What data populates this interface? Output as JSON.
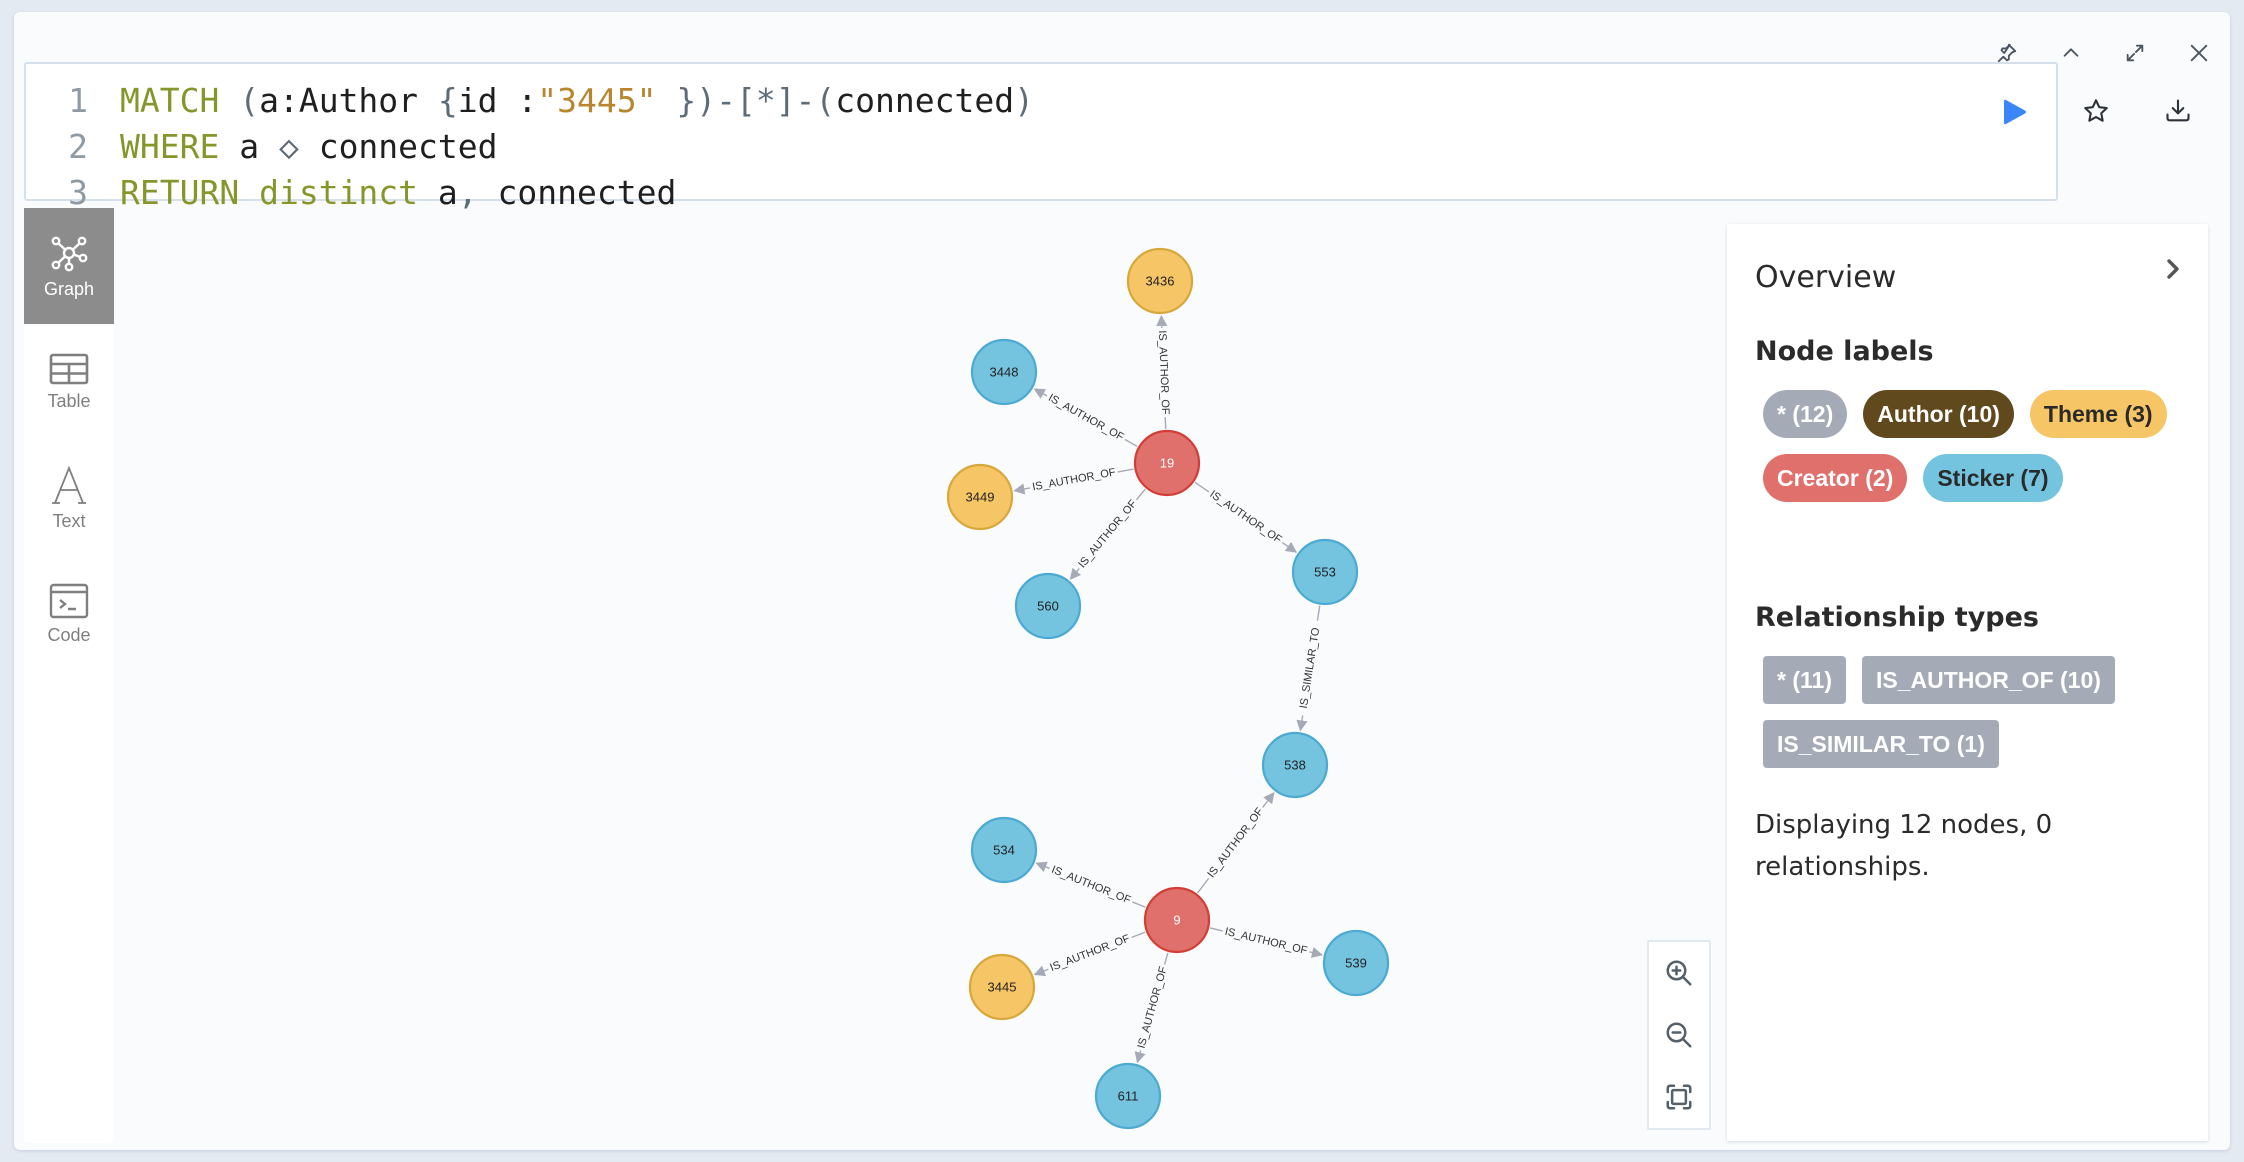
{
  "window_controls": {
    "pin": "pin-icon",
    "collapse": "chevron-up-icon",
    "expand": "expand-icon",
    "close": "close-icon"
  },
  "editor": {
    "lines": [
      {
        "number": "1",
        "tokens": [
          {
            "t": "MATCH",
            "c": "kw"
          },
          {
            "t": " ",
            "c": "pl"
          },
          {
            "t": "(",
            "c": "punc"
          },
          {
            "t": "a:Author ",
            "c": "pl"
          },
          {
            "t": "{",
            "c": "punc"
          },
          {
            "t": "id :",
            "c": "pl"
          },
          {
            "t": "\"3445\"",
            "c": "str"
          },
          {
            "t": " })-[*]-(",
            "c": "punc"
          },
          {
            "t": "connected",
            "c": "pl"
          },
          {
            "t": ")",
            "c": "punc"
          }
        ]
      },
      {
        "number": "2",
        "tokens": [
          {
            "t": "WHERE",
            "c": "kw"
          },
          {
            "t": " a ",
            "c": "pl"
          },
          {
            "t": "◇",
            "c": "punc"
          },
          {
            "t": " connected",
            "c": "pl"
          }
        ]
      },
      {
        "number": "3",
        "tokens": [
          {
            "t": "RETURN",
            "c": "kw"
          },
          {
            "t": " ",
            "c": "pl"
          },
          {
            "t": "distinct",
            "c": "kw"
          },
          {
            "t": " a",
            "c": "pl"
          },
          {
            "t": ",",
            "c": "punc"
          },
          {
            "t": " connected",
            "c": "pl"
          }
        ]
      }
    ],
    "run_color": "#3b86f6"
  },
  "sidebar": {
    "tabs": [
      {
        "label": "Graph",
        "icon": "graph-icon",
        "active": true
      },
      {
        "label": "Table",
        "icon": "table-icon",
        "active": false
      },
      {
        "label": "Text",
        "icon": "text-icon",
        "active": false
      },
      {
        "label": "Code",
        "icon": "code-icon",
        "active": false
      }
    ]
  },
  "graph": {
    "colors": {
      "Sticker": {
        "fill": "#74c4e0",
        "stroke": "#4ba9d2",
        "text": "#222222"
      },
      "Theme": {
        "fill": "#f6c566",
        "stroke": "#d8a73a",
        "text": "#222222"
      },
      "Creator": {
        "fill": "#e0706b",
        "stroke": "#d23d36",
        "text": "#ffffff"
      }
    },
    "edge_color": "#a5aab6",
    "nodes": [
      {
        "id": "3436",
        "type": "Theme",
        "caption": "3436"
      },
      {
        "id": "3448",
        "type": "Sticker",
        "caption": "3448"
      },
      {
        "id": "19",
        "type": "Creator",
        "caption": "19"
      },
      {
        "id": "3449",
        "type": "Theme",
        "caption": "3449"
      },
      {
        "id": "560",
        "type": "Sticker",
        "caption": "560"
      },
      {
        "id": "553",
        "type": "Sticker",
        "caption": "553"
      },
      {
        "id": "538",
        "type": "Sticker",
        "caption": "538"
      },
      {
        "id": "534",
        "type": "Sticker",
        "caption": "534"
      },
      {
        "id": "9",
        "type": "Creator",
        "caption": "9"
      },
      {
        "id": "3445",
        "type": "Theme",
        "caption": "3445"
      },
      {
        "id": "539",
        "type": "Sticker",
        "caption": "539"
      },
      {
        "id": "611",
        "type": "Sticker",
        "caption": "611"
      }
    ],
    "edges": [
      {
        "from": "19",
        "to": "3436",
        "type": "IS_AUTHOR_OF"
      },
      {
        "from": "19",
        "to": "3448",
        "type": "IS_AUTHOR_OF"
      },
      {
        "from": "19",
        "to": "3449",
        "type": "IS_AUTHOR_OF"
      },
      {
        "from": "19",
        "to": "560",
        "type": "IS_AUTHOR_OF"
      },
      {
        "from": "19",
        "to": "553",
        "type": "IS_AUTHOR_OF"
      },
      {
        "from": "553",
        "to": "538",
        "type": "IS_SIMILAR_TO"
      },
      {
        "from": "9",
        "to": "538",
        "type": "IS_AUTHOR_OF"
      },
      {
        "from": "9",
        "to": "534",
        "type": "IS_AUTHOR_OF"
      },
      {
        "from": "9",
        "to": "3445",
        "type": "IS_AUTHOR_OF"
      },
      {
        "from": "9",
        "to": "539",
        "type": "IS_AUTHOR_OF"
      },
      {
        "from": "9",
        "to": "611",
        "type": "IS_AUTHOR_OF"
      }
    ]
  },
  "zoom_controls": {
    "zoom_in": "zoom-in-icon",
    "zoom_out": "zoom-out-icon",
    "fit": "fit-screen-icon"
  },
  "overview": {
    "title": "Overview",
    "node_labels_heading": "Node labels",
    "node_labels": [
      {
        "label": "* (12)",
        "bg": "#a5abb6",
        "fg": "#ffffff"
      },
      {
        "label": "Author (10)",
        "bg": "#604a1d",
        "fg": "#ffffff"
      },
      {
        "label": "Theme (3)",
        "bg": "#f6c566",
        "fg": "#2a2a2a"
      },
      {
        "label": "Creator (2)",
        "bg": "#e0706b",
        "fg": "#ffffff"
      },
      {
        "label": "Sticker (7)",
        "bg": "#74c4e0",
        "fg": "#2a2a2a"
      }
    ],
    "relationship_types_heading": "Relationship types",
    "relationship_types": [
      {
        "label": "* (11)",
        "bg": "#a5abb6",
        "fg": "#ffffff"
      },
      {
        "label": "IS_AUTHOR_OF (10)",
        "bg": "#a5abb6",
        "fg": "#ffffff"
      },
      {
        "label": "IS_SIMILAR_TO (1)",
        "bg": "#a5abb6",
        "fg": "#ffffff"
      }
    ],
    "status": "Displaying 12 nodes, 0 relationships."
  }
}
